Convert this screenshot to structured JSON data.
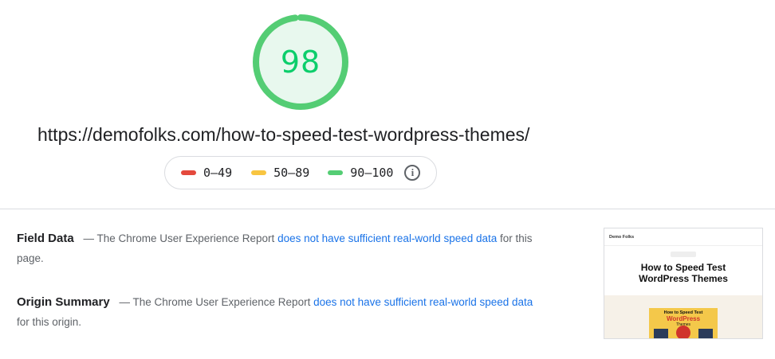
{
  "score": {
    "value": "98",
    "fraction": 0.98,
    "color": "#0cce6b",
    "fill_color": "#e8f8ee"
  },
  "url": "https://demofolks.com/how-to-speed-test-wordpress-themes/",
  "legend": {
    "items": [
      {
        "label": "0–49",
        "color": "#e4493d"
      },
      {
        "label": "50–89",
        "color": "#f8c541"
      },
      {
        "label": "90–100",
        "color": "#54cd74"
      }
    ],
    "info_icon": "info-icon"
  },
  "field_data": {
    "heading": "Field Data",
    "prefix": "— The Chrome User Experience Report",
    "link": "does not have sufficient real-world speed data",
    "suffix": "for this page."
  },
  "origin_summary": {
    "heading": "Origin Summary",
    "prefix": "— The Chrome User Experience Report",
    "link": "does not have sufficient real-world speed data",
    "suffix": "for this origin."
  },
  "thumbnail": {
    "brand": "Demo Folks",
    "title_line1": "How to Speed Test",
    "title_line2": "WordPress Themes",
    "featured_line1": "How to Speed Test",
    "featured_line2": "WordPress",
    "featured_line3": "Themes"
  }
}
